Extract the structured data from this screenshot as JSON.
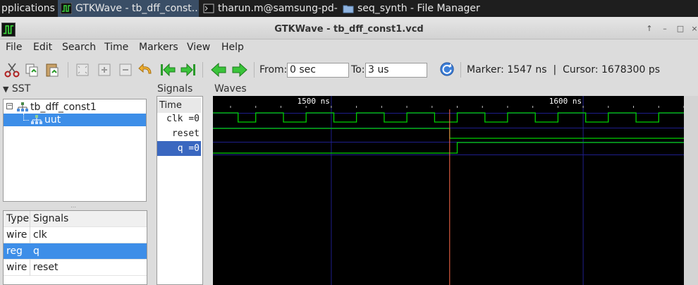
{
  "taskbar": {
    "items": [
      {
        "label": "pplications",
        "active": false
      },
      {
        "label": "GTKWave - tb_dff_const...",
        "active": true
      },
      {
        "label": "tharun.m@samsung-pd-...",
        "active": false
      },
      {
        "label": "seq_synth - File Manager",
        "active": false
      }
    ]
  },
  "window": {
    "title": "GTKWave - tb_dff_const1.vcd",
    "controls": [
      "↑",
      "–",
      "□",
      "×"
    ]
  },
  "menubar": [
    "File",
    "Edit",
    "Search",
    "Time",
    "Markers",
    "View",
    "Help"
  ],
  "toolbar": {
    "from_label": "From:",
    "from_value": "0 sec",
    "to_label": "To:",
    "to_value": "3 us",
    "marker_text": "Marker: 1547 ns  |  Cursor: 1678300 ps",
    "icons": [
      "cut-icon",
      "copy-icon",
      "paste-icon",
      "zoom-fit-icon",
      "zoom-in-icon",
      "zoom-out-icon",
      "undo-zoom-icon",
      "zoom-start-icon",
      "zoom-end-icon",
      "page-left-icon",
      "page-right-icon",
      "reload-icon"
    ]
  },
  "sst": {
    "header": "SST",
    "tree": [
      {
        "label": "tb_dff_const1",
        "selected": false
      },
      {
        "label": "uut",
        "selected": true
      }
    ],
    "table_headers": [
      "Type",
      "Signals"
    ],
    "rows": [
      {
        "type": "wire",
        "name": "clk",
        "selected": false
      },
      {
        "type": "reg",
        "name": "q",
        "selected": true
      },
      {
        "type": "wire",
        "name": "reset",
        "selected": false
      }
    ]
  },
  "signals": {
    "header": "Signals",
    "time_label": "Time",
    "items": [
      {
        "label": "clk =0",
        "selected": false
      },
      {
        "label": "reset =0",
        "selected": false
      },
      {
        "label": "q =0",
        "selected": true
      }
    ]
  },
  "waves": {
    "header": "Waves",
    "time_labels": [
      "1500 ns",
      "1600 ns"
    ],
    "colors": {
      "background": "#000000",
      "trace": "#00d000",
      "grid": "#1e1e8c",
      "cursor": "#ff6a4a"
    }
  },
  "chart_data": {
    "type": "line",
    "xlabel": "",
    "ylabel": "",
    "xlim": [
      1453,
      1640
    ],
    "ticks": [
      1500,
      1600
    ],
    "cursor_ns": 1547,
    "series": [
      {
        "name": "clk",
        "transitions_ns": [
          1463,
          1470,
          1481,
          1490,
          1501,
          1510,
          1521,
          1530,
          1541,
          1550,
          1561,
          1570,
          1581,
          1590,
          1601,
          1610,
          1621,
          1630,
          1641
        ],
        "initial": 1
      },
      {
        "name": "reset",
        "transitions_ns": [
          1547
        ],
        "initial": 1
      },
      {
        "name": "q",
        "transitions_ns": [
          1550
        ],
        "initial": 0
      }
    ]
  }
}
